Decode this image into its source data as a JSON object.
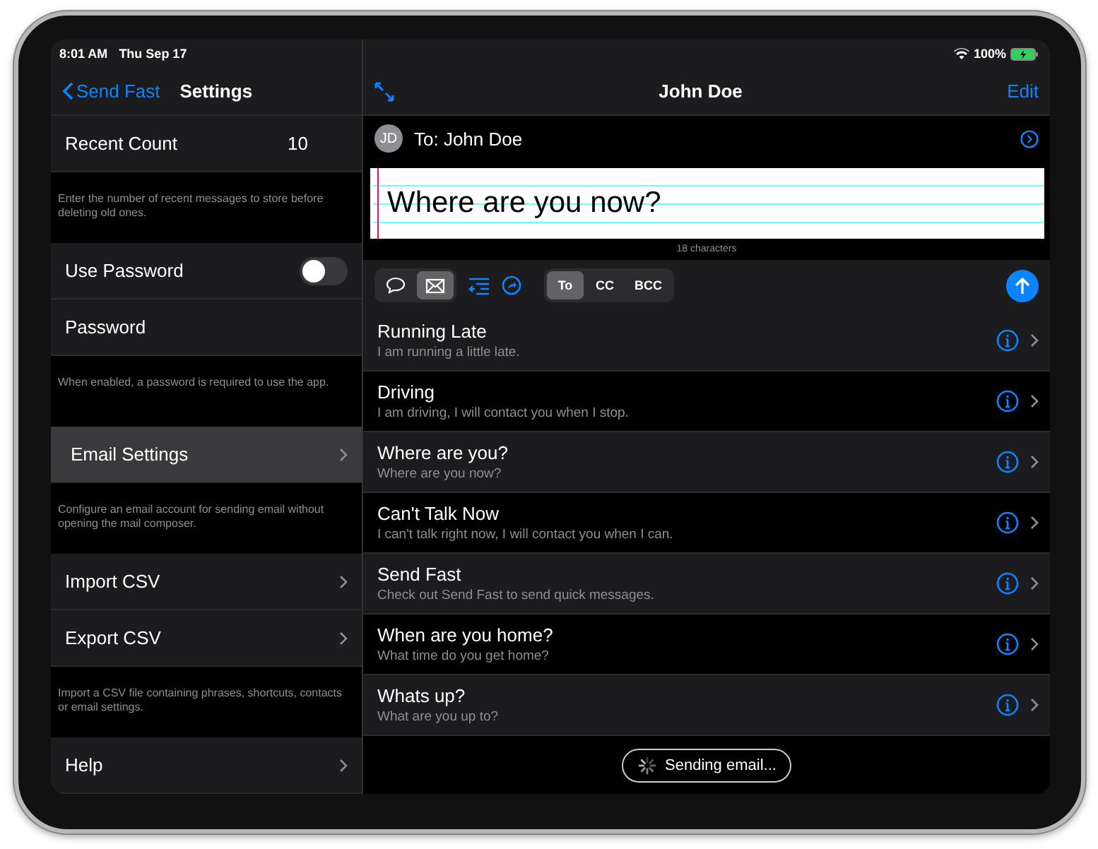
{
  "status_bar": {
    "time": "8:01 AM",
    "date": "Thu Sep 17",
    "battery": "100%"
  },
  "settings": {
    "back": "Send Fast",
    "title": "Settings",
    "sections": [
      {
        "rows": [
          {
            "kind": "value",
            "label": "Recent Count",
            "value": "10",
            "selected": false
          }
        ],
        "footer": "Enter the number of recent messages to store before deleting old ones."
      },
      {
        "rows": [
          {
            "kind": "toggle",
            "label": "Use Password",
            "on": false,
            "selected": false
          },
          {
            "kind": "plain",
            "label": "Password",
            "selected": false
          }
        ],
        "footer": "When enabled, a password is required to use the app."
      },
      {
        "rows": [
          {
            "kind": "disclosure",
            "label": "Email Settings",
            "selected": true
          }
        ],
        "footer": "Configure an email account for sending email without opening the mail composer."
      },
      {
        "rows": [
          {
            "kind": "disclosure",
            "label": "Import CSV",
            "selected": false
          },
          {
            "kind": "disclosure",
            "label": "Export CSV",
            "selected": false
          }
        ],
        "footer": "Import a CSV file containing phrases, shortcuts, contacts or email settings."
      },
      {
        "rows": [
          {
            "kind": "disclosure",
            "label": "Help",
            "selected": false
          }
        ]
      }
    ]
  },
  "compose": {
    "title": "John Doe",
    "edit": "Edit",
    "avatar": "JD",
    "recipient": "To: John Doe",
    "message": "Where are you now?",
    "char_count": "18 characters",
    "modes": [
      {
        "kind": "message",
        "selected": false
      },
      {
        "kind": "email",
        "selected": true
      }
    ],
    "fields": [
      {
        "label": "To",
        "selected": true
      },
      {
        "label": "CC",
        "selected": false
      },
      {
        "label": "BCC",
        "selected": false
      }
    ],
    "phrases": [
      {
        "title": "Running Late",
        "text": "I am running a little late."
      },
      {
        "title": "Driving",
        "text": "I am driving, I will contact you when I stop."
      },
      {
        "title": "Where are you?",
        "text": "Where are you now?"
      },
      {
        "title": "Can't Talk Now",
        "text": "I can't talk right now, I will contact you when I can."
      },
      {
        "title": "Send Fast",
        "text": "Check out Send Fast to send quick messages."
      },
      {
        "title": "When are you home?",
        "text": "What time do you get home?"
      },
      {
        "title": "Whats up?",
        "text": "What are you up to?"
      }
    ],
    "sending": "Sending email..."
  }
}
